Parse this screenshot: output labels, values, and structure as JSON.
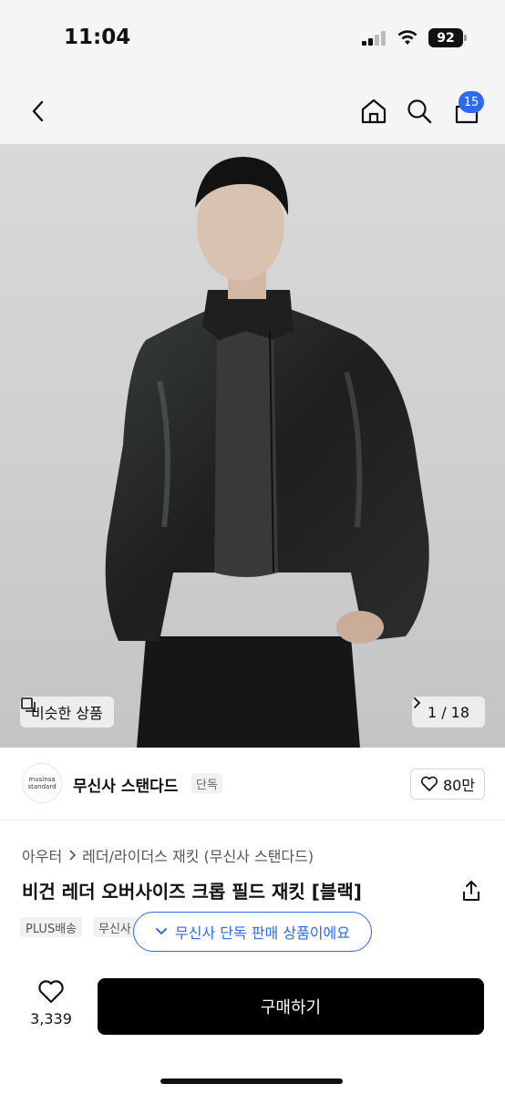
{
  "status": {
    "time": "11:04",
    "battery": "92"
  },
  "nav": {
    "cart_count": "15"
  },
  "hero": {
    "similar_label": "비슷한 상품",
    "page_indicator": "1 / 18"
  },
  "brand": {
    "logo_line1": "musinsa",
    "logo_line2": "standard",
    "name": "무신사 스탠다드",
    "tag": "단독",
    "likes": "80만"
  },
  "product": {
    "breadcrumb": [
      "아우터",
      "레더/라이더스 재킷 (무신사 스탠다드)"
    ],
    "title": "비건 레더 오버사이즈 크롭 필드 재킷 [블랙]",
    "tags": [
      "PLUS배송",
      "무신사"
    ],
    "exclusive_notice": "무신사 단독 판매 상품이에요"
  },
  "bottom": {
    "like_count": "3,339",
    "buy_label": "구매하기"
  },
  "colors": {
    "accent": "#2a6bf2",
    "buy": "#000000",
    "nav_bg": "#f5f5f6"
  }
}
